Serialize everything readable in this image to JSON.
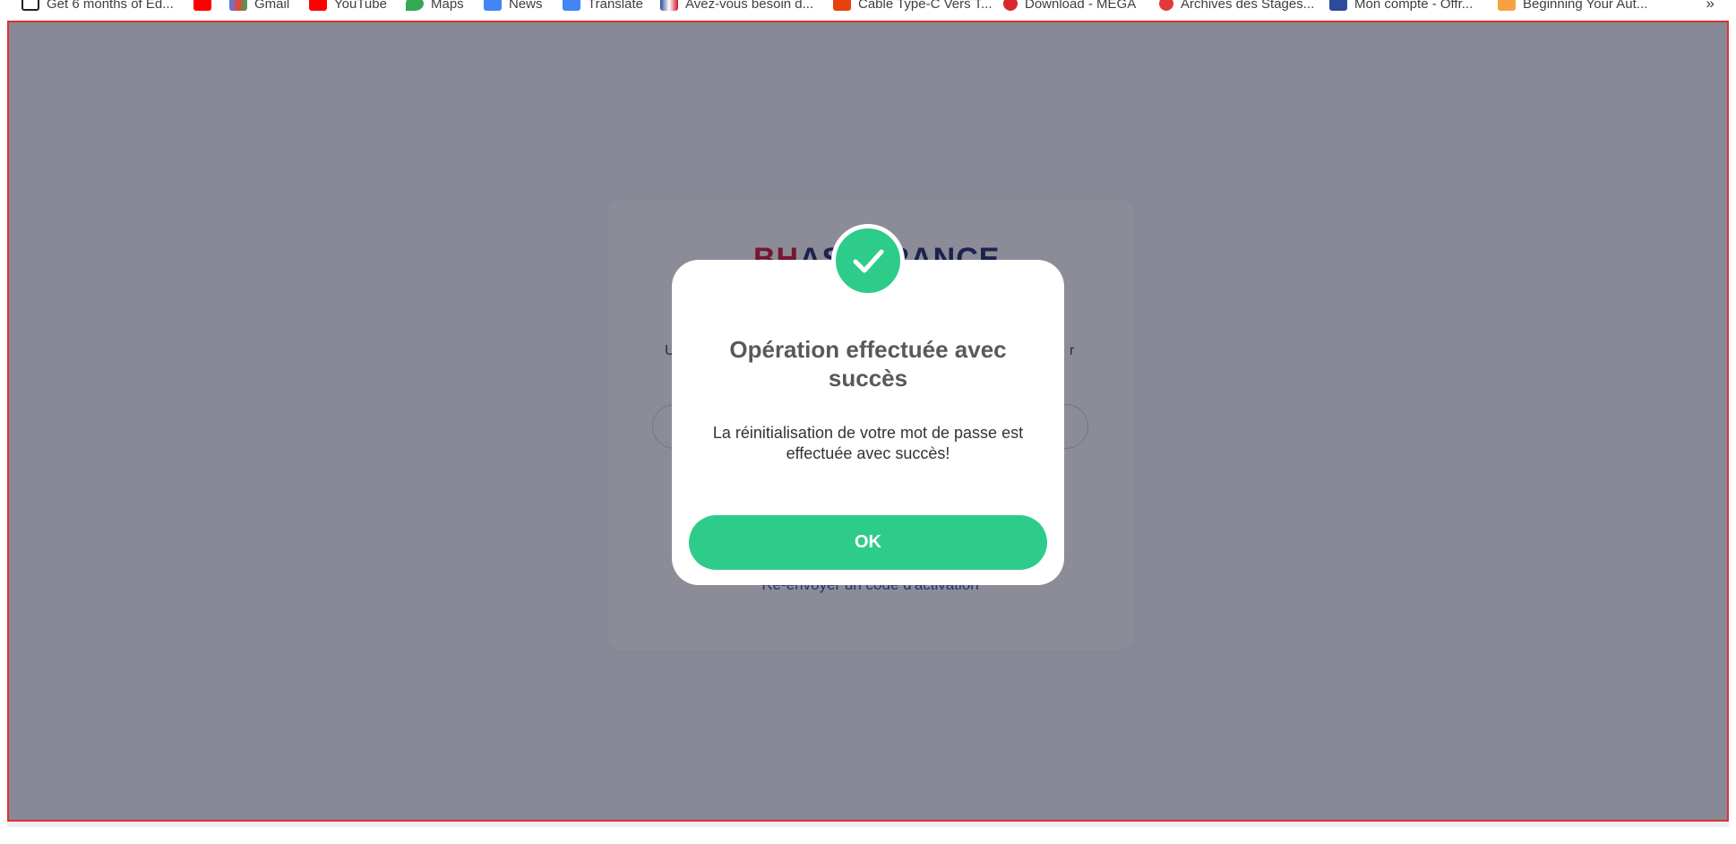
{
  "bookmarks": {
    "items": [
      {
        "label": "Get 6 months of Ed...",
        "icon": "terminal-icon",
        "color": "#202124"
      },
      {
        "label": "",
        "icon": "youtube-icon",
        "color": "#ff0000"
      },
      {
        "label": "Gmail",
        "icon": "gmail-icon",
        "color": "#ea4335"
      },
      {
        "label": "YouTube",
        "icon": "youtube-icon",
        "color": "#ff0000"
      },
      {
        "label": "Maps",
        "icon": "maps-icon",
        "color": "#34a853"
      },
      {
        "label": "News",
        "icon": "news-icon",
        "color": "#4285f4"
      },
      {
        "label": "Translate",
        "icon": "translate-icon",
        "color": "#4285f4"
      },
      {
        "label": "Avez-vous besoin d...",
        "icon": "flag-icon",
        "color": "#d4122b"
      },
      {
        "label": "Cable Type-C Vers T...",
        "icon": "cart-icon",
        "color": "#e8410c"
      },
      {
        "label": "Download - MEGA",
        "icon": "mega-icon",
        "color": "#d9272e"
      },
      {
        "label": "Archives des Stages...",
        "icon": "search-icon",
        "color": "#e53935"
      },
      {
        "label": "Mon compte - Offr...",
        "icon": "oe-icon",
        "color": "#2e4b9b"
      },
      {
        "label": "Beginning Your Aut...",
        "icon": "a-icon",
        "color": "#f4a340"
      }
    ],
    "more": "»"
  },
  "background": {
    "logo_bh": "BH",
    "logo_rest": "ASSURANCE",
    "text_left": "U",
    "text_right": "r",
    "link": "Re-envoyer un code d'activation"
  },
  "modal": {
    "title": "Opération effectuée avec succès",
    "body": "La réinitialisation de votre mot de passe est effectuée avec succès!",
    "ok_label": "OK",
    "icon": "check-icon"
  },
  "colors": {
    "accent": "#2ecc8a",
    "overlay": "rgba(23,26,48,0.5)",
    "frame_border": "#e03131"
  }
}
